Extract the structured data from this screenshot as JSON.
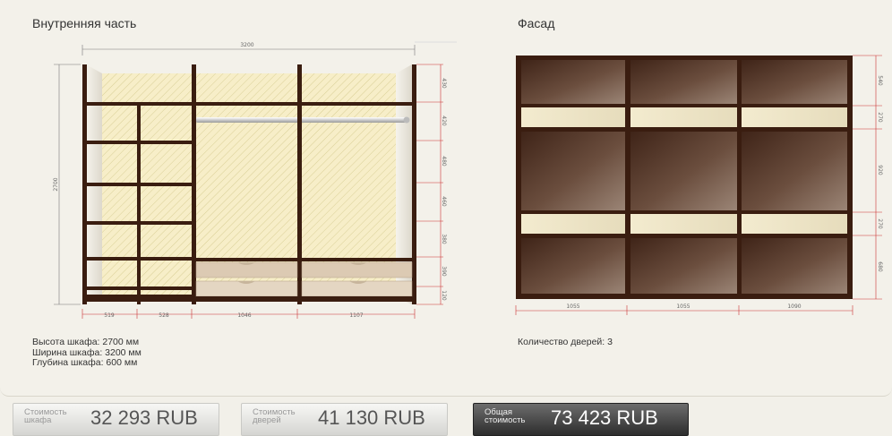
{
  "interior": {
    "title": "Внутренняя часть",
    "total_width": "3200",
    "total_height": "2700",
    "section_widths": [
      "519",
      "528",
      "1046",
      "1107"
    ],
    "vertical_dims": [
      "430",
      "420",
      "480",
      "460",
      "380",
      "390",
      "120"
    ],
    "specs": [
      "Высота шкафа: 2700 мм",
      "Ширина шкафа: 3200 мм",
      "Глубина шкафа: 600 мм"
    ]
  },
  "facade": {
    "title": "Фасад",
    "door_widths": [
      "1055",
      "1055",
      "1090"
    ],
    "vertical_dims": [
      "540",
      "270",
      "920",
      "270",
      "680"
    ],
    "doors_count": "Количество дверей: 3"
  },
  "costs": {
    "cabinet": {
      "label": "Стоимость шкафа",
      "value": "32 293  RUB"
    },
    "doors": {
      "label": "Стоимость дверей",
      "value": "41 130  RUB"
    },
    "total": {
      "label": "Общая стоимость",
      "value": "73 423  RUB"
    }
  },
  "colors": {
    "wood_dark": "#3a1d10",
    "wall_pattern": "#f6ecc4",
    "drawer": "#dfcdb6",
    "glass_dark": "#5a3e2f",
    "glass_light": "#eee3c3",
    "dimension_red": "#cc3333"
  }
}
